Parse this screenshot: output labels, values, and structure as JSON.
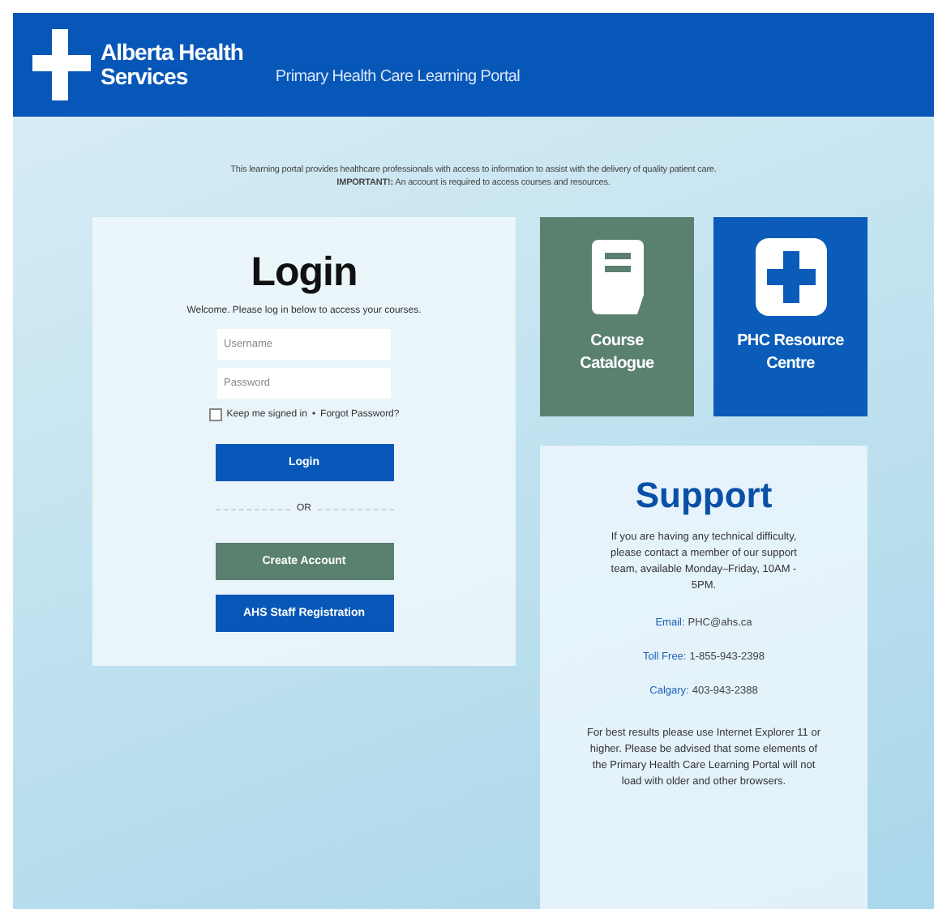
{
  "header": {
    "brand_line_1": "Alberta Health",
    "brand_line_2": "Services",
    "portal_title": "Primary Health Care Learning Portal"
  },
  "intro": [
    "This learning portal provides healthcare professionals with access to information to assist with the delivery of quality patient care.",
    "**IMPORTANT!:** An account is required to access courses and resources."
  ],
  "login": {
    "title": "Login",
    "welcome": "Welcome. Please log in below to access your courses.",
    "username": {
      "placeholder": "Username"
    },
    "password": {
      "placeholder": "Password"
    },
    "remember": {
      "label": "Keep me signed in",
      "checked": false
    },
    "separator": "•",
    "forgot_link": "Forgot Password?",
    "login_button": "Login",
    "or": "OR",
    "buttons": [
      {
        "label": "Create Account",
        "kind": "secondary"
      },
      {
        "label": "AHS Staff Registration",
        "kind": "primary"
      }
    ]
  },
  "tiles": [
    {
      "label": "Course Catalogue",
      "kind": "book",
      "color": "#5a8070"
    },
    {
      "label": "PHC Resource Centre",
      "kind": "plus",
      "color": "#0a5cb8"
    }
  ],
  "support": {
    "title": "Support",
    "message": "If you are having any technical difficulty, please contact a member of our support team, available Monday–Friday, 10AM - 5PM.",
    "contacts": [
      {
        "label": "Email:",
        "value": "PHC@ahs.ca"
      },
      {
        "label": "Toll Free:",
        "value": "1-855-943-2398"
      },
      {
        "label": "Calgary:",
        "value": "403-943-2388"
      }
    ],
    "note": "For best results please use Internet Explorer 11 or higher. Please be advised that some elements of the Primary Health Care Learning Portal will not load with older and other browsers."
  }
}
